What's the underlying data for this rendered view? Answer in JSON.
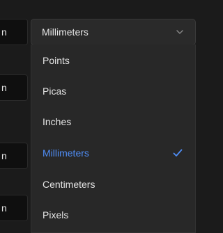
{
  "background_fields": [
    {
      "value": "n"
    },
    {
      "value": "n"
    },
    {
      "value": "n"
    },
    {
      "value": "n"
    }
  ],
  "select": {
    "value": "Millimeters",
    "icon": "chevron-down-icon"
  },
  "menu": {
    "items": [
      {
        "label": "Points",
        "selected": false
      },
      {
        "label": "Picas",
        "selected": false
      },
      {
        "label": "Inches",
        "selected": false
      },
      {
        "label": "Millimeters",
        "selected": true
      },
      {
        "label": "Centimeters",
        "selected": false
      },
      {
        "label": "Pixels",
        "selected": false
      }
    ],
    "selected_icon": "checkmark-icon"
  },
  "colors": {
    "background": "#1b1b1b",
    "menu": "#282828",
    "selected": "#4f8df5",
    "text": "#e4e4e4"
  }
}
